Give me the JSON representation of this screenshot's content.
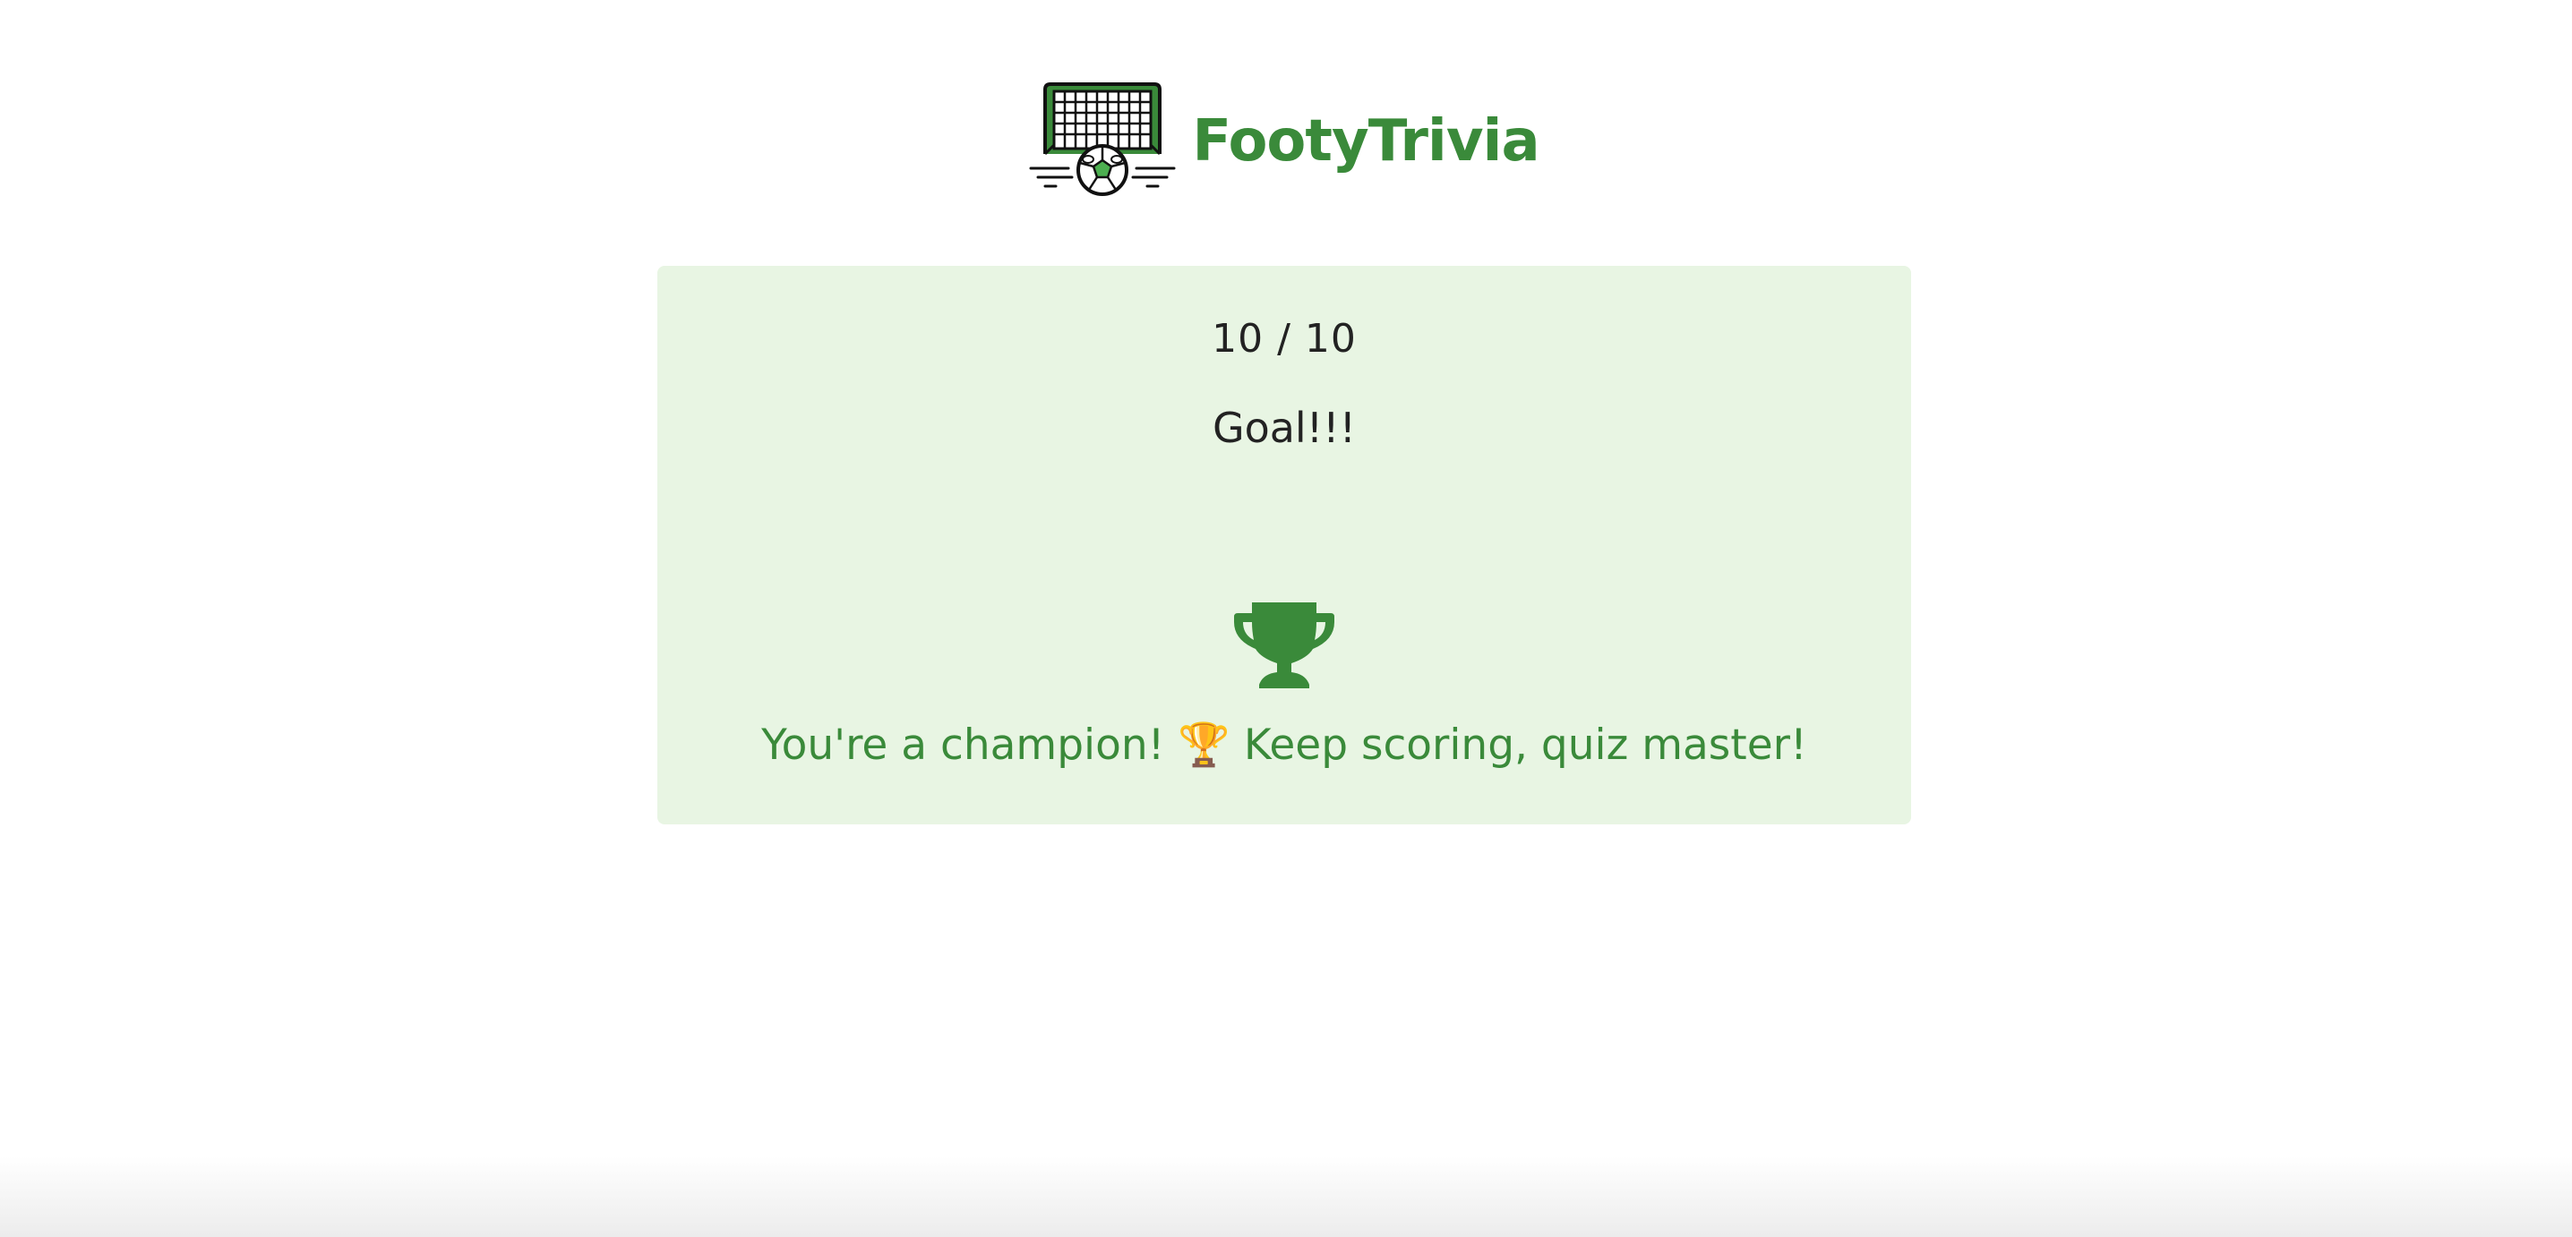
{
  "brand": {
    "name": "FootyTrivia",
    "logo_icon": "goal-net-with-soccer-ball-icon",
    "color": "#3a8a3a"
  },
  "result": {
    "score_text": "10 / 10",
    "headline": "Goal!!!",
    "trophy_icon": "trophy-icon",
    "message": "You're a champion! 🏆 Keep scoring, quiz master!",
    "card_background": "#e8f5e3",
    "accent_color": "#3a8a3a"
  }
}
